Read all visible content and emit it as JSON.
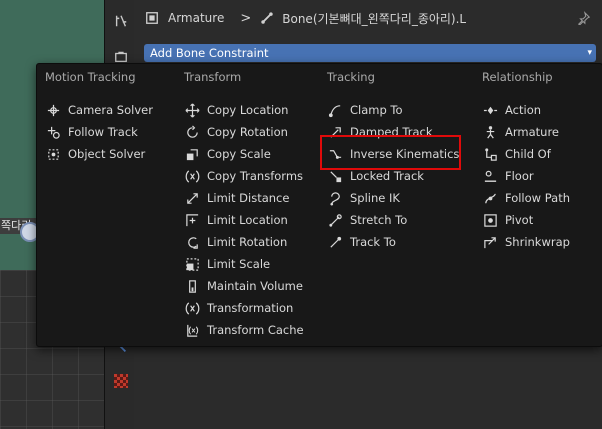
{
  "viewport": {
    "object_label": "쪽다리_타"
  },
  "header": {
    "object_name": "Armature",
    "separator": ">",
    "bone_name": "Bone(기본뼈대_왼쪽다리_종아리).L"
  },
  "add_constraint": {
    "label": "Add Bone Constraint"
  },
  "menu": {
    "columns": [
      {
        "header": "Motion Tracking",
        "items": [
          {
            "label": "Camera Solver",
            "icon": "camera-solver-icon"
          },
          {
            "label": "Follow Track",
            "icon": "follow-track-icon"
          },
          {
            "label": "Object Solver",
            "icon": "object-solver-icon"
          }
        ]
      },
      {
        "header": "Transform",
        "items": [
          {
            "label": "Copy Location",
            "icon": "copy-location-icon"
          },
          {
            "label": "Copy Rotation",
            "icon": "copy-rotation-icon"
          },
          {
            "label": "Copy Scale",
            "icon": "copy-scale-icon"
          },
          {
            "label": "Copy Transforms",
            "icon": "copy-transforms-icon"
          },
          {
            "label": "Limit Distance",
            "icon": "limit-distance-icon"
          },
          {
            "label": "Limit Location",
            "icon": "limit-location-icon"
          },
          {
            "label": "Limit Rotation",
            "icon": "limit-rotation-icon"
          },
          {
            "label": "Limit Scale",
            "icon": "limit-scale-icon"
          },
          {
            "label": "Maintain Volume",
            "icon": "maintain-volume-icon"
          },
          {
            "label": "Transformation",
            "icon": "transformation-icon"
          },
          {
            "label": "Transform Cache",
            "icon": "transform-cache-icon"
          }
        ]
      },
      {
        "header": "Tracking",
        "items": [
          {
            "label": "Clamp To",
            "icon": "clamp-to-icon"
          },
          {
            "label": "Damped Track",
            "icon": "damped-track-icon"
          },
          {
            "label": "Inverse Kinematics",
            "icon": "inverse-kinematics-icon"
          },
          {
            "label": "Locked Track",
            "icon": "locked-track-icon"
          },
          {
            "label": "Spline IK",
            "icon": "spline-ik-icon"
          },
          {
            "label": "Stretch To",
            "icon": "stretch-to-icon"
          },
          {
            "label": "Track To",
            "icon": "track-to-icon"
          }
        ]
      },
      {
        "header": "Relationship",
        "items": [
          {
            "label": "Action",
            "icon": "action-icon"
          },
          {
            "label": "Armature",
            "icon": "armature-icon"
          },
          {
            "label": "Child Of",
            "icon": "child-of-icon"
          },
          {
            "label": "Floor",
            "icon": "floor-icon"
          },
          {
            "label": "Follow Path",
            "icon": "follow-path-icon"
          },
          {
            "label": "Pivot",
            "icon": "pivot-icon"
          },
          {
            "label": "Shrinkwrap",
            "icon": "shrinkwrap-icon"
          }
        ]
      }
    ]
  },
  "colors": {
    "menu_bg": "#181818",
    "accent": "#4772b3",
    "highlight_border": "#e00a0a",
    "viewport_green": "#3f6b5a"
  }
}
